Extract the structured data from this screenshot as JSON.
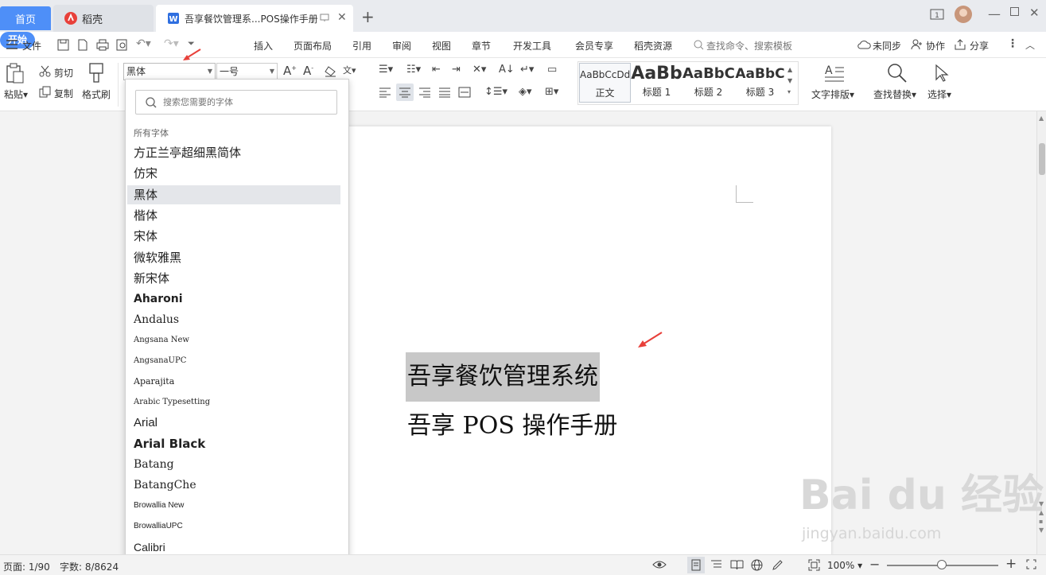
{
  "tabs": {
    "home": "首页",
    "daoke": "稻壳",
    "doc": "吾享餐饮管理系...POS操作手册"
  },
  "menu": {
    "file": "文件",
    "start": "开始",
    "insert": "插入",
    "layout": "页面布局",
    "reference": "引用",
    "review": "审阅",
    "view": "视图",
    "chapter": "章节",
    "devtools": "开发工具",
    "vip": "会员专享",
    "daoke_res": "稻壳资源",
    "search_cmd": "查找命令、搜索模板",
    "unsync": "未同步",
    "collab": "协作",
    "share": "分享"
  },
  "ribbon": {
    "paste": "粘贴",
    "cut": "剪切",
    "copy": "复制",
    "format_painter": "格式刷",
    "font_name": "黑体",
    "font_size": "一号",
    "styles": [
      {
        "preview": "AaBbCcDd",
        "name": "正文"
      },
      {
        "preview": "AaBb",
        "name": "标题 1"
      },
      {
        "preview": "AaBbC",
        "name": "标题 2"
      },
      {
        "preview": "AaBbC",
        "name": "标题 3"
      }
    ],
    "text_layout": "文字排版",
    "find_replace": "查找替换",
    "select": "选择"
  },
  "font_dropdown": {
    "search_placeholder": "搜索您需要的字体",
    "section_label": "所有字体",
    "selected": "黑体",
    "fonts": [
      "方正兰亭超细黑简体",
      "仿宋",
      "黑体",
      "楷体",
      "宋体",
      "微软雅黑",
      "新宋体",
      "Aharoni",
      "Andalus",
      "Angsana New",
      "AngsanaUPC",
      "Aparajita",
      "Arabic Typesetting",
      "Arial",
      "Arial Black",
      "Batang",
      "BatangChe",
      "Browallia New",
      "BrowalliaUPC",
      "Calibri"
    ]
  },
  "document": {
    "line1": "吾享餐饮管理系统",
    "line2": "吾享 POS 操作手册"
  },
  "status": {
    "page": "页面: 1/90",
    "words": "字数: 8/8624",
    "zoom": "100%"
  },
  "watermark": {
    "brand": "Bai du 经验",
    "url": "jingyan.baidu.com"
  },
  "colors": {
    "accent": "#4e8ff8",
    "highlight": "#c8c8c8",
    "annotation": "#e8403a"
  }
}
